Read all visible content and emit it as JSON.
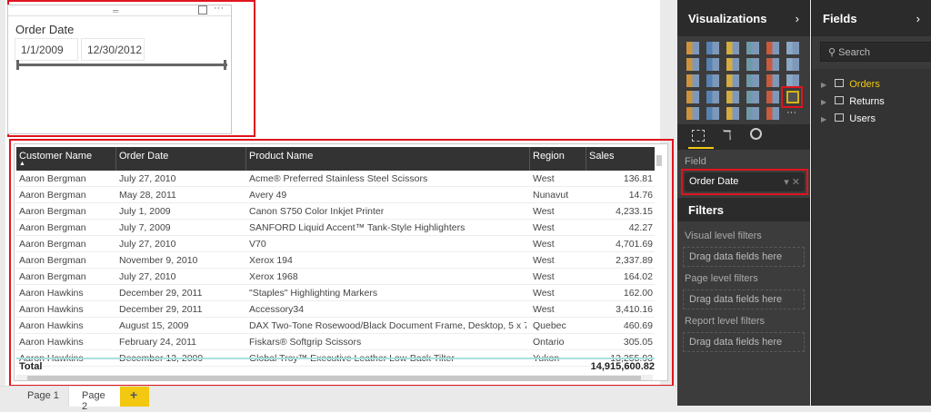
{
  "slicer": {
    "title": "Order Date",
    "start": "1/1/2009",
    "end": "12/30/2012",
    "range_fraction": [
      0,
      1
    ]
  },
  "table": {
    "columns": [
      "Customer Name",
      "Order Date",
      "Product Name",
      "Region",
      "Sales"
    ],
    "rows": [
      [
        "Aaron Bergman",
        "July 27, 2010",
        "Acme® Preferred Stainless Steel Scissors",
        "West",
        "136.81"
      ],
      [
        "Aaron Bergman",
        "May 28, 2011",
        "Avery 49",
        "Nunavut",
        "14.76"
      ],
      [
        "Aaron Bergman",
        "July 1, 2009",
        "Canon S750 Color Inkjet Printer",
        "West",
        "4,233.15"
      ],
      [
        "Aaron Bergman",
        "July 7, 2009",
        "SANFORD Liquid Accent™ Tank-Style Highlighters",
        "West",
        "42.27"
      ],
      [
        "Aaron Bergman",
        "July 27, 2010",
        "V70",
        "West",
        "4,701.69"
      ],
      [
        "Aaron Bergman",
        "November 9, 2010",
        "Xerox 194",
        "West",
        "2,337.89"
      ],
      [
        "Aaron Bergman",
        "July 27, 2010",
        "Xerox 1968",
        "West",
        "164.02"
      ],
      [
        "Aaron Hawkins",
        "December 29, 2011",
        "\"Staples\" Highlighting Markers",
        "West",
        "162.00"
      ],
      [
        "Aaron Hawkins",
        "December 29, 2011",
        "Accessory34",
        "West",
        "3,410.16"
      ],
      [
        "Aaron Hawkins",
        "August 15, 2009",
        "DAX Two-Tone Rosewood/Black Document Frame, Desktop, 5 x 7",
        "Quebec",
        "460.69"
      ],
      [
        "Aaron Hawkins",
        "February 24, 2011",
        "Fiskars® Softgrip Scissors",
        "Ontario",
        "305.05"
      ],
      [
        "Aaron Hawkins",
        "December 13, 2009",
        "Global Troy™ Executive Leather Low-Back Tilter",
        "Yukon",
        "13,255.93"
      ]
    ],
    "total_label": "Total",
    "total_value": "14,915,600.82"
  },
  "tabs": [
    {
      "label": "Page 1"
    },
    {
      "label": "Page 2",
      "active": true
    },
    {
      "label": "+"
    }
  ],
  "visualizations": {
    "title": "Visualizations",
    "field_label": "Field",
    "field_value": "Order Date"
  },
  "filters": {
    "title": "Filters",
    "visual": "Visual level filters",
    "page": "Page level filters",
    "report": "Report level filters",
    "drop": "Drag data fields here"
  },
  "fields": {
    "title": "Fields",
    "search_placeholder": "Search",
    "tables": [
      "Orders",
      "Returns",
      "Users"
    ]
  },
  "colors": {
    "accent": "#f2c811",
    "highlight": "#e0141e"
  }
}
